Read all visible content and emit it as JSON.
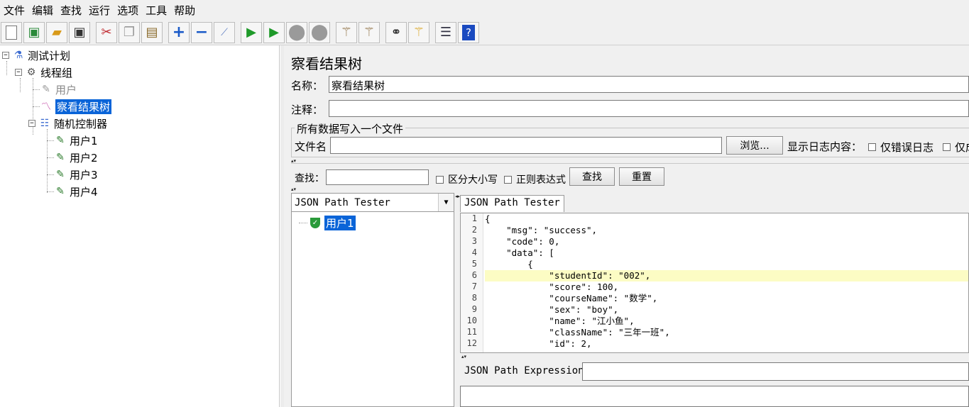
{
  "menu": [
    "文件",
    "编辑",
    "查找",
    "运行",
    "选项",
    "工具",
    "帮助"
  ],
  "toolbar": {
    "icons": [
      "new-icon",
      "templates-icon",
      "open-icon",
      "save-icon",
      "cut-icon",
      "copy-icon",
      "paste-icon",
      "expand-icon",
      "collapse-icon",
      "toggle-icon",
      "start-icon",
      "start-no-pause-icon",
      "stop-icon",
      "shutdown-icon",
      "clear-icon",
      "clear-all-icon",
      "search-icon",
      "reset-search-icon",
      "function-helper-icon",
      "help-icon"
    ]
  },
  "tree": {
    "nodes": [
      {
        "label": "测试计划",
        "icon": "flask-icon"
      },
      {
        "label": "线程组",
        "icon": "gear-icon"
      },
      {
        "label": "用户",
        "icon": "pen-icon"
      },
      {
        "label": "察看结果树",
        "icon": "graph-icon"
      },
      {
        "label": "随机控制器",
        "icon": "controller-icon"
      },
      {
        "label": "用户1",
        "icon": "pen-icon"
      },
      {
        "label": "用户2",
        "icon": "pen-icon"
      },
      {
        "label": "用户3",
        "icon": "pen-icon"
      },
      {
        "label": "用户4",
        "icon": "pen-icon"
      }
    ]
  },
  "panel": {
    "title": "察看结果树",
    "name_label": "名称：",
    "name_value": "察看结果树",
    "comment_label": "注释：",
    "comment_value": "",
    "file_group_title": "所有数据写入一个文件",
    "filename_label": "文件名",
    "filename_value": "",
    "browse_button": "浏览...",
    "log_content_label": "显示日志内容：",
    "errors_only_label": "仅错误日志",
    "success_only_label": "仅成",
    "search_label": "查找：",
    "search_value": "",
    "case_sensitive_label": "区分大小写",
    "regex_label": "正则表达式",
    "find_button": "查找",
    "reset_button": "重置"
  },
  "results": {
    "renderer": "JSON Path Tester",
    "tab_label": "JSON Path Tester",
    "sample": "用户1",
    "code_lines": [
      "{",
      "    \"msg\": \"success\",",
      "    \"code\": 0,",
      "    \"data\": [",
      "        {",
      "            \"studentId\": \"002\",",
      "            \"score\": 100,",
      "            \"courseName\": \"数学\",",
      "            \"sex\": \"boy\",",
      "            \"name\": \"江小鱼\",",
      "            \"className\": \"三年一班\",",
      "            \"id\": 2,"
    ],
    "line_numbers": [
      "1",
      "2",
      "3",
      "4",
      "5",
      "6",
      "7",
      "8",
      "9",
      "10",
      "11",
      "12"
    ],
    "expression_label": "JSON Path Expression",
    "expression_value": ""
  }
}
